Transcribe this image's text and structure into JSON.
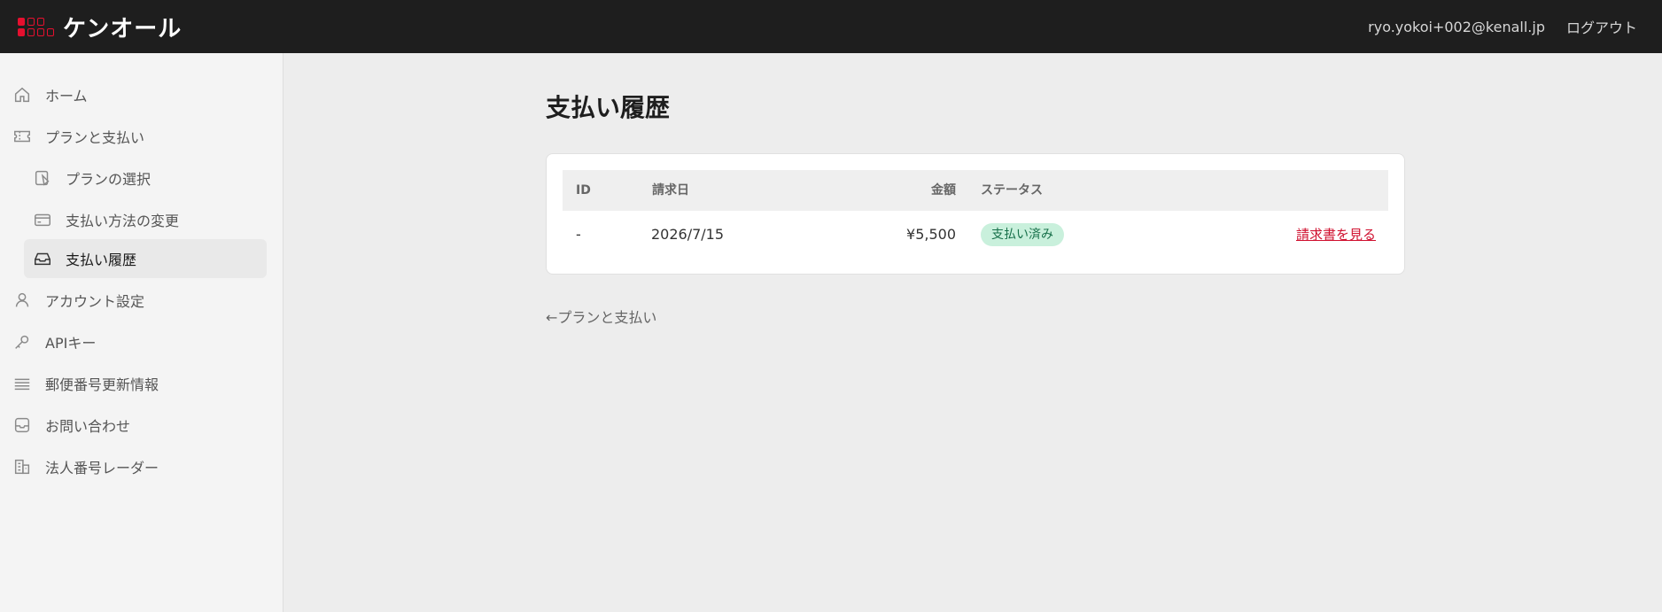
{
  "header": {
    "logo_text": "ケンオール",
    "logo_colors": [
      "#e5102f",
      "#e5102f",
      "#e5102f",
      "#e5102f",
      "#e5102f",
      "#e5102f",
      "#e5102f",
      "#e5102f"
    ],
    "user_email": "ryo.yokoi+002@kenall.jp",
    "logout_label": "ログアウト"
  },
  "sidebar": {
    "items": [
      {
        "label": "ホーム",
        "icon": "home-icon"
      },
      {
        "label": "プランと支払い",
        "icon": "ticket-icon"
      },
      {
        "label": "プランの選択",
        "icon": "plan-icon"
      },
      {
        "label": "支払い方法の変更",
        "icon": "credit-card-icon"
      },
      {
        "label": "支払い履歴",
        "icon": "inbox-icon",
        "active": true
      },
      {
        "label": "アカウント設定",
        "icon": "user-icon"
      },
      {
        "label": "APIキー",
        "icon": "key-icon"
      },
      {
        "label": "郵便番号更新情報",
        "icon": "list-icon"
      },
      {
        "label": "お問い合わせ",
        "icon": "mail-inbox-icon"
      },
      {
        "label": "法人番号レーダー",
        "icon": "building-icon"
      }
    ]
  },
  "main": {
    "title": "支払い履歴",
    "table": {
      "columns": [
        "ID",
        "請求日",
        "金額",
        "ステータス"
      ],
      "rows": [
        {
          "id": "-",
          "date": "2026/7/15",
          "amount": "¥5,500",
          "status": "支払い済み",
          "action": "請求書を見る"
        }
      ]
    },
    "back_link": "←プランと支払い"
  },
  "colors": {
    "accent": "#d0102f",
    "status_paid_bg": "#c9f0dc",
    "status_paid_text": "#17704a",
    "topbar_bg": "#1e1e1e"
  }
}
